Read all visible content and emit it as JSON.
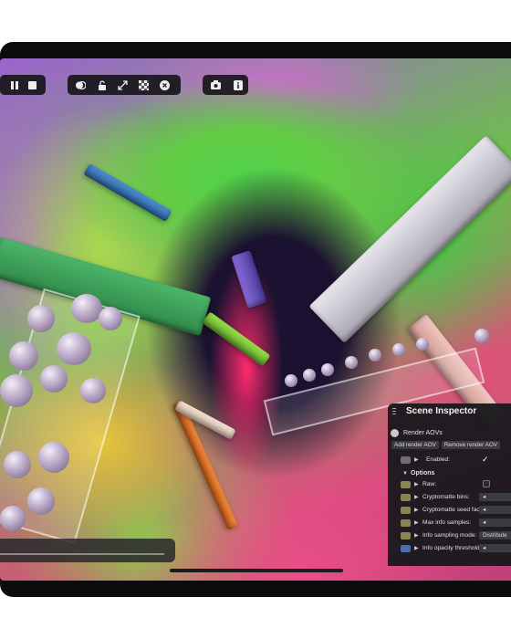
{
  "toolbar": {
    "playback": [
      {
        "name": "pause",
        "glyph": "⏸"
      },
      {
        "name": "stop",
        "glyph": "■"
      }
    ],
    "view": [
      {
        "name": "toggle-display"
      },
      {
        "name": "lock"
      },
      {
        "name": "expand"
      },
      {
        "name": "checkerboard"
      },
      {
        "name": "close"
      }
    ],
    "extras": [
      {
        "name": "camera"
      },
      {
        "name": "info"
      }
    ]
  },
  "inspector": {
    "title": "Scene Inspector",
    "section": "Render AOVs",
    "add_button": "Add render AOV",
    "remove_button": "Remove render AOV",
    "enabled_label": "Enabled:",
    "enabled_check": "✓",
    "options_label": "Options",
    "options_arrow": "▼",
    "rows": [
      {
        "label": "Raw:",
        "value": ""
      },
      {
        "label": "Cryptomatte bins:",
        "value": "◂"
      },
      {
        "label": "Cryptomatte seed factor:",
        "value": "◂"
      },
      {
        "label": "Max info samples:",
        "value": "◂"
      },
      {
        "label": "Info sampling mode:",
        "value": "Distribute"
      },
      {
        "label": "Info opacity threshold:",
        "value": "◂"
      }
    ]
  },
  "colors": {
    "panel": "#18181c",
    "accent_blue": "#4a6fb0",
    "toggle_olive": "#8a8452"
  }
}
